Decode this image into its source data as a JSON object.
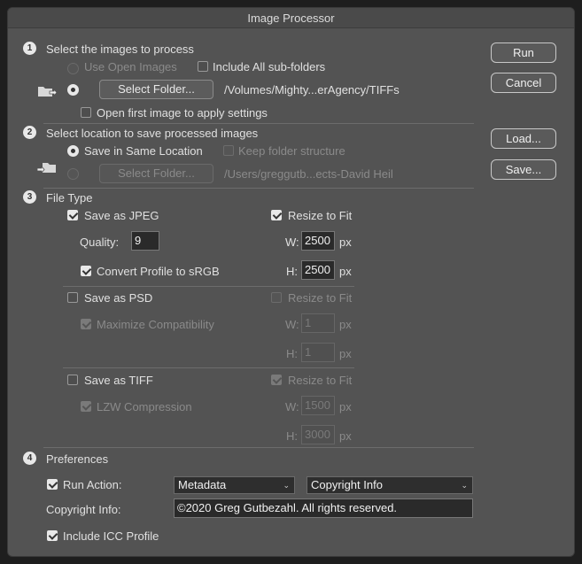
{
  "window": {
    "title": "Image Processor"
  },
  "section1": {
    "number": "1",
    "heading": "Select the images to process",
    "use_open_images": "Use Open Images",
    "include_subfolders": "Include All sub-folders",
    "select_folder_btn": "Select Folder...",
    "folder_path": "/Volumes/Mighty...erAgency/TIFFs",
    "open_first_image": "Open first image to apply settings"
  },
  "section2": {
    "number": "2",
    "heading": "Select location to save processed images",
    "save_same_location": "Save in Same Location",
    "keep_folder_structure": "Keep folder structure",
    "select_folder_btn": "Select Folder...",
    "folder_path": "/Users/greggutb...ects-David Heil"
  },
  "section3": {
    "number": "3",
    "heading": "File Type",
    "jpeg": {
      "save_label": "Save as JPEG",
      "quality_label": "Quality:",
      "quality_value": "9",
      "convert_profile": "Convert Profile to sRGB",
      "resize_label": "Resize to Fit",
      "w_label": "W:",
      "w_value": "2500",
      "h_label": "H:",
      "h_value": "2500",
      "unit": "px"
    },
    "psd": {
      "save_label": "Save as PSD",
      "maximize": "Maximize Compatibility",
      "resize_label": "Resize to Fit",
      "w_label": "W:",
      "w_value": "1",
      "h_label": "H:",
      "h_value": "1",
      "unit": "px"
    },
    "tiff": {
      "save_label": "Save as TIFF",
      "lzw": "LZW Compression",
      "resize_label": "Resize to Fit",
      "w_label": "W:",
      "w_value": "1500",
      "h_label": "H:",
      "h_value": "3000",
      "unit": "px"
    }
  },
  "section4": {
    "number": "4",
    "heading": "Preferences",
    "run_action": "Run Action:",
    "action_set": "Metadata",
    "action_name": "Copyright Info",
    "copyright_label": "Copyright Info:",
    "copyright_value": "©2020 Greg Gutbezahl. All rights reserved.",
    "include_icc": "Include ICC Profile"
  },
  "buttons": {
    "run": "Run",
    "cancel": "Cancel",
    "load": "Load...",
    "save": "Save..."
  },
  "icons": {
    "select_check": "checkmark-icon",
    "chevron": "chevron-down-icon",
    "folder_source": "folder-arrow-icon",
    "folder_dest": "folder-dest-icon"
  }
}
